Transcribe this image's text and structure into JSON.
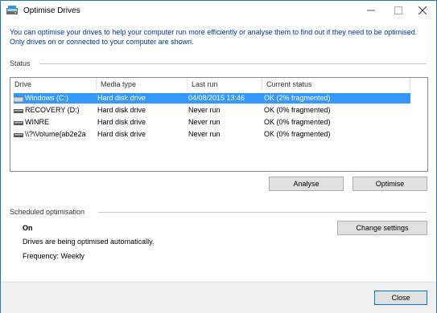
{
  "window": {
    "title": "Optimise Drives"
  },
  "intro_text": "You can optimise your drives to help your computer run more efficiently or analyse them to find out if they need to be optimised. Only drives on or connected to your computer are shown.",
  "status": {
    "section_label": "Status",
    "columns": [
      "Drive",
      "Media type",
      "Last run",
      "Current status"
    ],
    "drives": [
      {
        "drive": "Windows (C:)",
        "media_type": "Hard disk drive",
        "last_run": "04/08/2015 13:46",
        "current_status": "OK (2% fragmented)",
        "icon": "windows-drive-icon",
        "selected": true
      },
      {
        "drive": "RECOVERY (D:)",
        "media_type": "Hard disk drive",
        "last_run": "Never run",
        "current_status": "OK (0% fragmented)",
        "icon": "drive-icon",
        "selected": false
      },
      {
        "drive": "WINRE",
        "media_type": "Hard disk drive",
        "last_run": "Never run",
        "current_status": "OK (0% fragmented)",
        "icon": "drive-icon",
        "selected": false
      },
      {
        "drive": "\\\\?\\Volume{ab2e2a",
        "media_type": "Hard disk drive",
        "last_run": "Never run",
        "current_status": "OK (0% fragmented)",
        "icon": "drive-icon",
        "selected": false
      }
    ],
    "analyse_label": "Analyse",
    "optimise_label": "Optimise"
  },
  "scheduled": {
    "section_label": "Scheduled optimisation",
    "state": "On",
    "description": "Drives are being optimised automatically.",
    "frequency": "Frequency: Weekly",
    "change_settings_label": "Change settings"
  },
  "footer": {
    "close_label": "Close"
  },
  "colors": {
    "selection": "#3399ff",
    "intro_text": "#0033a0",
    "window_border": "#1f76c2"
  }
}
